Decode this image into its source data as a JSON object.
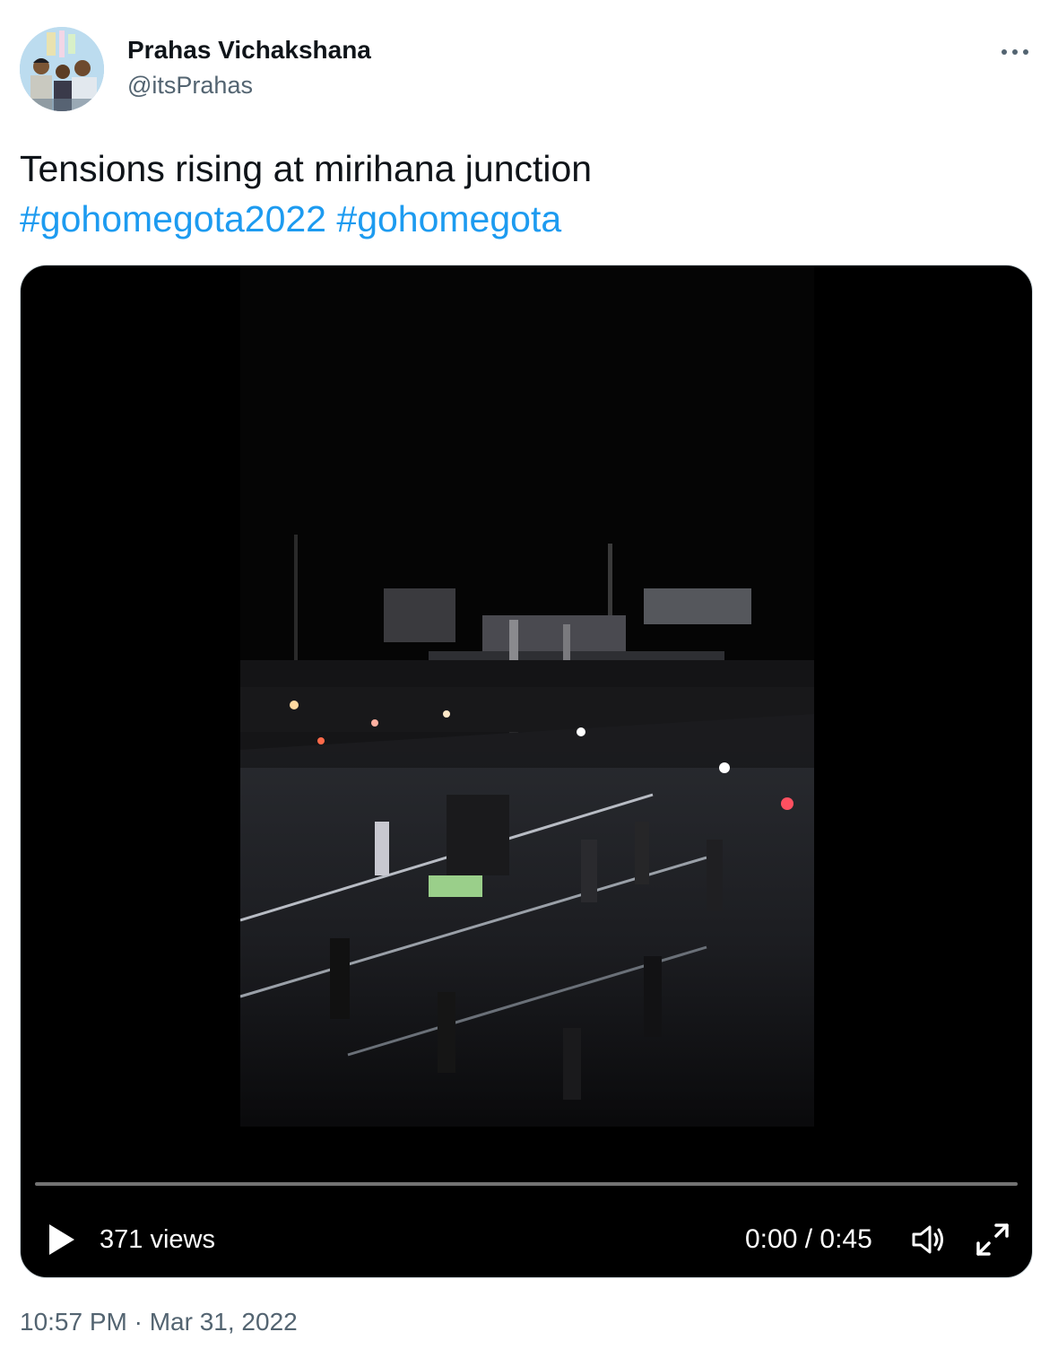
{
  "author": {
    "name": "Prahas Vichakshana",
    "handle": "@itsPrahas"
  },
  "tweet": {
    "text": "Tensions rising at mirihana junction",
    "hashtags": [
      "#gohomegota2022",
      "#gohomegota"
    ]
  },
  "video": {
    "views": "371 views",
    "time": "0:00 / 0:45",
    "progress": 0.0
  },
  "icons": {
    "more": "more-icon",
    "play": "play-icon",
    "volume": "volume-icon",
    "fullscreen": "fullscreen-icon"
  },
  "meta": {
    "timestamp": "10:57 PM · Mar 31, 2022"
  },
  "colors": {
    "hashtag": "#1d9bf0",
    "secondary_text": "#536471",
    "primary_text": "#0f1419"
  }
}
